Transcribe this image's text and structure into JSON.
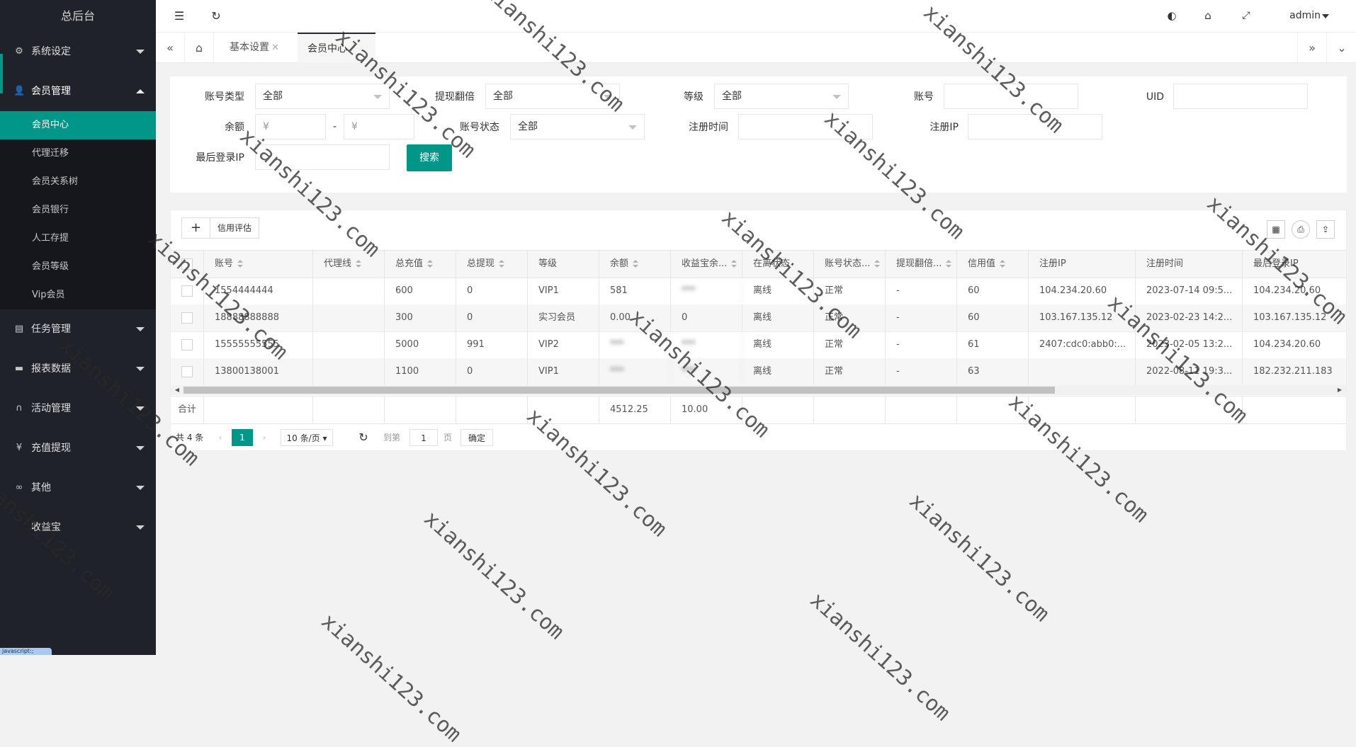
{
  "sidebar": {
    "logo": "总后台",
    "groups": [
      {
        "label": "系统设定"
      },
      {
        "label": "会员管理"
      },
      {
        "label": "任务管理"
      },
      {
        "label": "报表数据"
      },
      {
        "label": "活动管理"
      },
      {
        "label": "充值提现"
      },
      {
        "label": "其他"
      },
      {
        "label": "收益宝"
      }
    ],
    "member_items": [
      "会员中心",
      "代理迁移",
      "会员关系树",
      "会员银行",
      "人工存提",
      "会员等级",
      "Vip会员"
    ],
    "status_badge": "javascript:;"
  },
  "header": {
    "user": "admin"
  },
  "tabs": [
    {
      "label": "基本设置"
    },
    {
      "label": "会员中心"
    }
  ],
  "search": {
    "account_type_label": "账号类型",
    "account_type_value": "全部",
    "withdraw_double_label": "提现翻倍",
    "withdraw_double_value": "全部",
    "level_label": "等级",
    "level_value": "全部",
    "account_label": "账号",
    "uid_label": "UID",
    "balance_label": "余额",
    "balance_min_placeholder": "¥",
    "balance_max_placeholder": "¥",
    "range_dash": "-",
    "account_status_label": "账号状态",
    "account_status_value": "全部",
    "register_time_label": "注册时间",
    "register_ip_label": "注册IP",
    "last_login_ip_label": "最后登录IP",
    "search_button": "搜索"
  },
  "toolbar": {
    "add_label": "+",
    "credit_label": "信用评估"
  },
  "table": {
    "columns": [
      "账号",
      "代理线",
      "总充值",
      "总提现",
      "等级",
      "余额",
      "收益宝余...",
      "在离状态",
      "账号状态...",
      "提现翻倍...",
      "信用值",
      "注册IP",
      "注册时间",
      "最后登录IP"
    ],
    "rows": [
      {
        "account": "1554444444",
        "agent": "",
        "recharge": "600",
        "withdraw": "0",
        "level": "VIP1",
        "balance": "581",
        "yield": "***",
        "online": "离线",
        "status": "正常",
        "double": "-",
        "credit": "60",
        "reg_ip": "104.234.20.60",
        "reg_time": "2023-07-14 09:5...",
        "last_ip": "104.234.20.60"
      },
      {
        "account": "18888888888",
        "agent": "",
        "recharge": "300",
        "withdraw": "0",
        "level": "实习会员",
        "balance": "0.00",
        "yield": "0",
        "online": "离线",
        "status": "正常",
        "double": "-",
        "credit": "60",
        "reg_ip": "103.167.135.12",
        "reg_time": "2023-02-23 14:2...",
        "last_ip": "103.167.135.12"
      },
      {
        "account": "15555555555",
        "agent": "",
        "recharge": "5000",
        "withdraw": "991",
        "level": "VIP2",
        "balance": "***",
        "yield": "***",
        "online": "离线",
        "status": "正常",
        "double": "-",
        "credit": "61",
        "reg_ip": "2407:cdc0:abb0:...",
        "reg_time": "2023-02-05 13:2...",
        "last_ip": "104.234.20.60"
      },
      {
        "account": "13800138001",
        "agent": "",
        "recharge": "1100",
        "withdraw": "0",
        "level": "VIP1",
        "balance": "***",
        "yield": "***",
        "online": "离线",
        "status": "正常",
        "double": "-",
        "credit": "63",
        "reg_ip": "",
        "reg_time": "2022-08-11 19:3...",
        "last_ip": "182.232.211.183"
      }
    ],
    "footer": {
      "label": "合计",
      "balance_total": "4512.25",
      "yield_total": "10.00"
    }
  },
  "pager": {
    "total": "共 4 条",
    "current_page": "1",
    "page_size": "10 条/页",
    "goto_label": "到第",
    "goto_value": "1",
    "page_unit": "页",
    "confirm": "确定"
  },
  "watermark": "xianshi123.com",
  "colors": {
    "accent": "#009688",
    "sidebar": "#20222a"
  }
}
